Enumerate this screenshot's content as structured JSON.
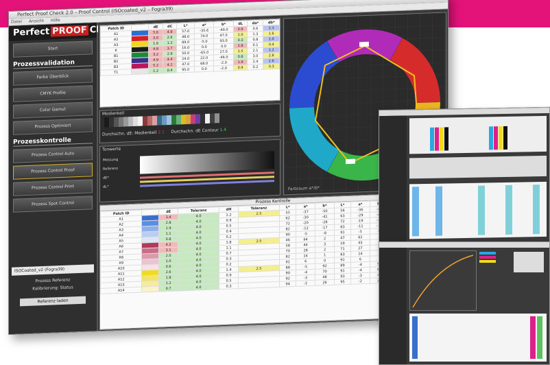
{
  "window": {
    "title": "Perfect Proof Check 2.0 – Proof Control (ISOcoated_v2 – Fogra39)",
    "menu": [
      "Datei",
      "Ansicht",
      "Hilfe"
    ]
  },
  "sidebar": {
    "logo_left": "Perfect",
    "logo_mid": "PROOF",
    "logo_right": "Check",
    "start": "Start",
    "section1": "Prozessvalidation",
    "items1": [
      "Farbe Überblick",
      "CMYK Profile",
      "Color Gamut",
      "Prozess Optimiert"
    ],
    "section2": "Prozesskontrolle",
    "items2": [
      "Prozess Control Auto",
      "Prozess Control Proof",
      "Prozess Control Print",
      "Prozess Spot Control"
    ],
    "select_value": "ISOCoated_v2 (Fogra39)",
    "profile_label": "Prozess Referenz",
    "status_label": "Kalibrierung: Status",
    "ref_button": "Referenz laden"
  },
  "top_table": {
    "headers": [
      "Patch ID",
      "",
      "dE",
      "dC",
      "L*",
      "a*",
      "b*",
      "dL",
      "da*",
      "db*"
    ],
    "rows": [
      [
        "A1",
        "#2a6fd6",
        "5.6",
        "4.8",
        "57.0",
        "-35.6",
        "-49.0",
        "0.9",
        "0.6",
        "2.3"
      ],
      [
        "A2",
        "#d81f26",
        "3.0",
        "2.6",
        "48.0",
        "74.0",
        "47.0",
        "1.0",
        "1.3",
        "1.6"
      ],
      [
        "A3",
        "#f0d818",
        "1.6",
        "1.2",
        "89.0",
        "-5.0",
        "93.0",
        "0.3",
        "0.8",
        "1.0"
      ],
      [
        "K",
        "#1b1b1b",
        "4.8",
        "3.7",
        "16.0",
        "0.0",
        "0.0",
        "2.8",
        "0.1",
        "0.4"
      ],
      [
        "B1",
        "#1a8a3a",
        "3.2",
        "2.9",
        "50.0",
        "-65.0",
        "27.0",
        "1.5",
        "2.1",
        "1.2"
      ],
      [
        "B2",
        "#3a2f8a",
        "4.9",
        "4.4",
        "24.0",
        "22.0",
        "-46.0",
        "0.8",
        "3.0",
        "2.8"
      ],
      [
        "B3",
        "#b8185a",
        "5.2",
        "4.1",
        "47.0",
        "68.0",
        "-2.0",
        "1.9",
        "2.4",
        "2.6"
      ],
      [
        "T1",
        "#e6e6e6",
        "1.2",
        "0.4",
        "95.0",
        "0.0",
        "-2.0",
        "0.9",
        "0.2",
        "0.3"
      ]
    ]
  },
  "strip": {
    "title": "Medienkeil",
    "left_label": "Durchschn. dE: Medienkeil",
    "left_value": "2.1",
    "right_label": "Durchschn. dE Contour",
    "right_value": "1.4"
  },
  "gradient": {
    "title": "Tonwerte",
    "rows": [
      "Messung",
      "Referenz",
      "dE*",
      "dL*"
    ]
  },
  "gamut": {
    "label": "Farbraum a*/b*"
  },
  "bottom_table": {
    "title": "Prozess Kontrolle",
    "headers": [
      "Patch ID",
      "",
      "dE",
      "Toleranz",
      "dH",
      "Toleranz",
      "L*",
      "a*",
      "b*",
      "L*",
      "a*",
      "b*",
      "dL",
      "da",
      "db"
    ],
    "rows": [
      [
        "A1",
        "#3a6fd0",
        "3.4",
        "4.0",
        "1.2",
        "2.5",
        "55",
        "-37",
        "-50",
        "56",
        "-36",
        "-48",
        "0.9",
        "1.1",
        "2.0"
      ],
      [
        "A2",
        "#5a8ee0",
        "2.8",
        "4.0",
        "0.9",
        "",
        "62",
        "-30",
        "-41",
        "63",
        "-29",
        "-40",
        "1.0",
        "0.7",
        "1.3"
      ],
      [
        "A3",
        "#8cb0ea",
        "1.9",
        "4.0",
        "0.5",
        "",
        "72",
        "-20",
        "-28",
        "72",
        "-19",
        "-27",
        "0.3",
        "0.5",
        "0.8"
      ],
      [
        "A4",
        "#b8cef2",
        "1.1",
        "4.0",
        "0.4",
        "",
        "82",
        "-12",
        "-17",
        "83",
        "-11",
        "-16",
        "0.6",
        "0.4",
        "0.7"
      ],
      [
        "A5",
        "#dbe6f7",
        "0.8",
        "4.0",
        "0.2",
        "",
        "90",
        "-5",
        "-8",
        "91",
        "-5",
        "-7",
        "0.7",
        "0.2",
        "0.5"
      ],
      [
        "A6",
        "#b23a5a",
        "4.2",
        "4.0",
        "1.8",
        "2.5",
        "46",
        "64",
        "2",
        "47",
        "62",
        "3",
        "1.2",
        "1.9",
        "1.2"
      ],
      [
        "A7",
        "#c86e86",
        "3.1",
        "4.0",
        "1.1",
        "",
        "58",
        "44",
        "3",
        "59",
        "43",
        "4",
        "0.9",
        "1.1",
        "0.9"
      ],
      [
        "A8",
        "#da9aac",
        "2.0",
        "4.0",
        "0.7",
        "",
        "70",
        "28",
        "2",
        "71",
        "27",
        "3",
        "0.6",
        "0.6",
        "0.8"
      ],
      [
        "A9",
        "#eac4cf",
        "1.0",
        "4.0",
        "0.3",
        "",
        "82",
        "14",
        "1",
        "83",
        "14",
        "1",
        "0.5",
        "0.3",
        "0.4"
      ],
      [
        "A10",
        "#f7e1e6",
        "0.6",
        "4.0",
        "0.2",
        "",
        "91",
        "6",
        "0",
        "91",
        "6",
        "1",
        "0.2",
        "0.2",
        "0.3"
      ],
      [
        "A11",
        "#f0dc18",
        "2.6",
        "4.0",
        "1.4",
        "2.5",
        "88",
        "-5",
        "92",
        "89",
        "-4",
        "90",
        "0.8",
        "0.9",
        "2.0"
      ],
      [
        "A12",
        "#f2e466",
        "1.8",
        "4.0",
        "0.9",
        "",
        "90",
        "-4",
        "70",
        "91",
        "-4",
        "69",
        "0.6",
        "0.5",
        "1.2"
      ],
      [
        "A13",
        "#f5ec9c",
        "1.2",
        "4.0",
        "0.5",
        "",
        "92",
        "-3",
        "48",
        "93",
        "-3",
        "47",
        "0.5",
        "0.4",
        "0.9"
      ],
      [
        "A14",
        "#f8f3c8",
        "0.7",
        "4.0",
        "0.3",
        "",
        "94",
        "-2",
        "26",
        "95",
        "-2",
        "26",
        "0.3",
        "0.2",
        "0.5"
      ]
    ]
  },
  "colors": {
    "banner": "#e4137a",
    "accent_gold": "#d8b22c"
  }
}
